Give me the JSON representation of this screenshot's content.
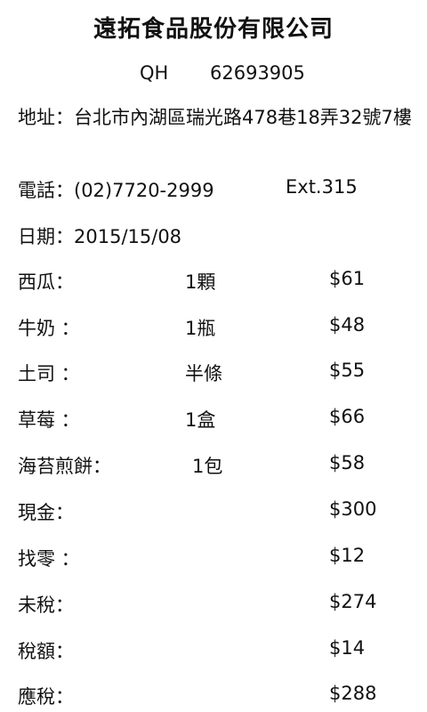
{
  "receipt": {
    "company": "遠拓食品股份有限公司",
    "qh_label": "QH",
    "qh_value": "62693905",
    "address_label": "地址：",
    "address": "台北市內湖區瑞光路478巷18弄32號7樓",
    "phone_label": "電話：",
    "phone": "(02)7720-2999",
    "ext": "Ext.315",
    "date_label": "日期：",
    "date": "2015/15/08",
    "items": [
      {
        "name": "西瓜：",
        "qty": "1顆",
        "price": "$61"
      },
      {
        "name": "牛奶 ：",
        "qty": "1瓶",
        "price": "$48"
      },
      {
        "name": "土司 ：",
        "qty": "半條",
        "price": "$55"
      },
      {
        "name": "草莓 ：",
        "qty": "1盒",
        "price": "$66"
      },
      {
        "name": "海苔煎餅：",
        "qty": "1包",
        "price": "$58"
      }
    ],
    "summary": [
      {
        "label": "現金：",
        "value": "$300"
      },
      {
        "label": "找零 ：",
        "value": "$12"
      },
      {
        "label": "未稅：",
        "value": "$274"
      },
      {
        "label": "稅額：",
        "value": "$14"
      },
      {
        "label": "應稅：",
        "value": "$288"
      }
    ]
  }
}
